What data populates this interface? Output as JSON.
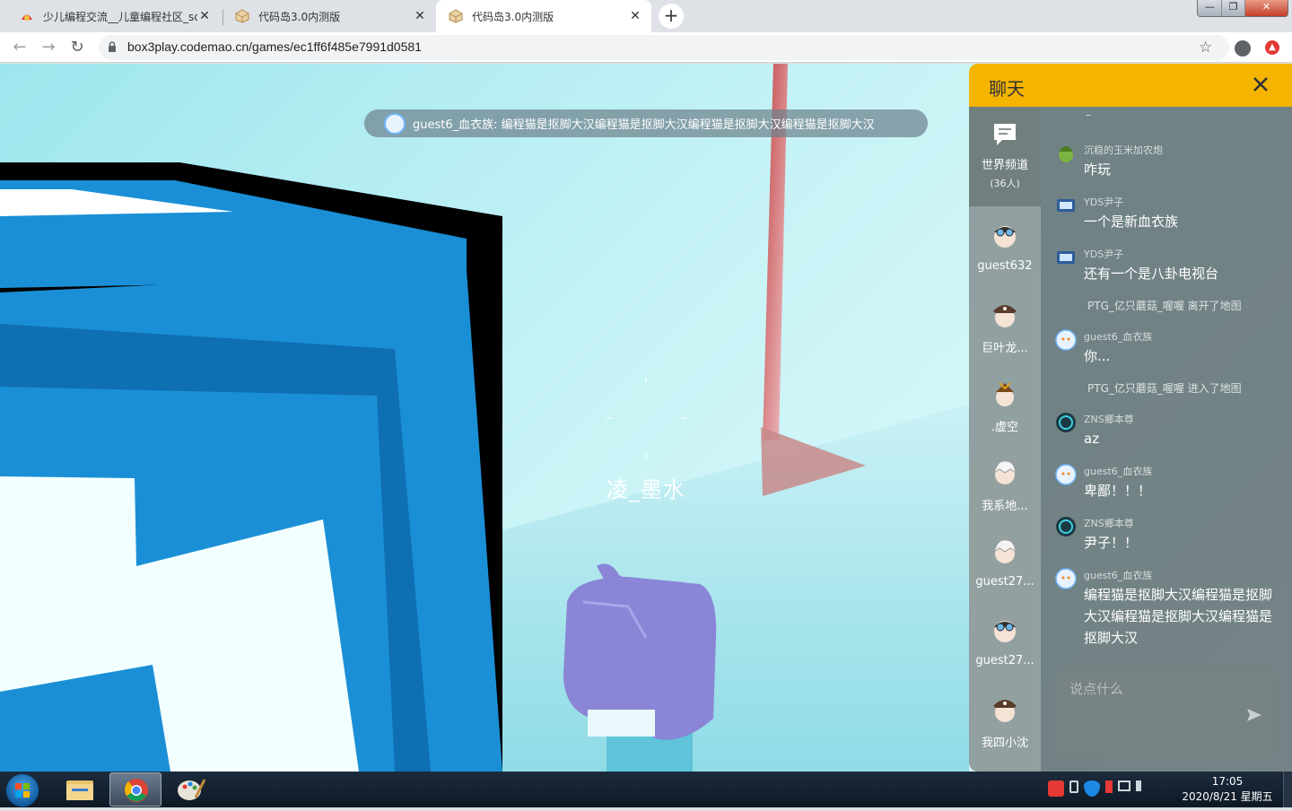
{
  "browser": {
    "tabs": [
      {
        "title": "少儿编程交流__儿童编程社区_sc",
        "active": false,
        "favicon": "codemao-logo-icon"
      },
      {
        "title": "代码岛3.0内测版",
        "active": false,
        "favicon": "box-icon"
      },
      {
        "title": "代码岛3.0内测版",
        "active": true,
        "favicon": "box-icon"
      }
    ],
    "new_tab_label": "+",
    "close_glyph": "✕",
    "url": "box3play.codemao.cn/games/ec1ff6f485e7991d0581",
    "window_controls": {
      "minimize": "—",
      "maximize": "❐",
      "close": "✕"
    }
  },
  "game": {
    "announcement": "guest6_血衣族: 编程猫是抠脚大汉编程猫是抠脚大汉编程猫是抠脚大汉编程猫是抠脚大汉",
    "player_name": "凌_墨水"
  },
  "chat": {
    "title": "聊天",
    "world_channel": {
      "label": "世界频道",
      "count": "(36人)"
    },
    "members": [
      {
        "name": "guest632",
        "avatar": "goggles-avatar-icon"
      },
      {
        "name": "巨叶龙...",
        "avatar": "pirate-hat-avatar-icon"
      },
      {
        "name": ".虚空",
        "avatar": "samurai-avatar-icon"
      },
      {
        "name": "我系地...",
        "avatar": "white-hair-avatar-icon"
      },
      {
        "name": "guest27...",
        "avatar": "white-hair-avatar-icon"
      },
      {
        "name": "guest27...",
        "avatar": "goggles-avatar-icon"
      },
      {
        "name": "我四小沈",
        "avatar": "pirate-hat-avatar-icon"
      }
    ],
    "top_fragment": "–",
    "messages": [
      {
        "type": "msg",
        "user": "沉稳的玉米加农炮",
        "text": "咋玩",
        "avatar": "plant-avatar-icon"
      },
      {
        "type": "msg",
        "user": "YDS尹子",
        "text": "一个是新血衣族",
        "avatar": "tv-avatar-icon"
      },
      {
        "type": "msg",
        "user": "YDS尹子",
        "text": "还有一个是八卦电视台",
        "avatar": "tv-avatar-icon"
      },
      {
        "type": "sys",
        "text": "PTG_亿只蘑菇_喔喔 离开了地图"
      },
      {
        "type": "msg",
        "user": "guest6_血衣族",
        "text": "你...",
        "avatar": "cat-avatar-icon"
      },
      {
        "type": "sys",
        "text": "PTG_亿只蘑菇_喔喔 进入了地图"
      },
      {
        "type": "msg",
        "user": "ZNS鄉本尊",
        "text": "az",
        "avatar": "dark-orb-avatar-icon"
      },
      {
        "type": "msg",
        "user": "guest6_血衣族",
        "text": "卑鄙！！！",
        "avatar": "cat-avatar-icon"
      },
      {
        "type": "msg",
        "user": "ZNS鄉本尊",
        "text": "尹子！！",
        "avatar": "dark-orb-avatar-icon"
      },
      {
        "type": "msg",
        "user": "guest6_血衣族",
        "text": "编程猫是抠脚大汉编程猫是抠脚大汉编程猫是抠脚大汉编程猫是抠脚大汉",
        "avatar": "cat-avatar-icon"
      }
    ],
    "input_placeholder": "说点什么"
  },
  "taskbar": {
    "apps": [
      "file-explorer-icon",
      "chrome-icon",
      "paint-icon"
    ],
    "time": "17:05",
    "date": "2020/8/21 星期五"
  },
  "colors": {
    "chat_header": "#f4b400",
    "block_blue": "#1a8fd6",
    "pet_purple": "#8a85d6"
  }
}
